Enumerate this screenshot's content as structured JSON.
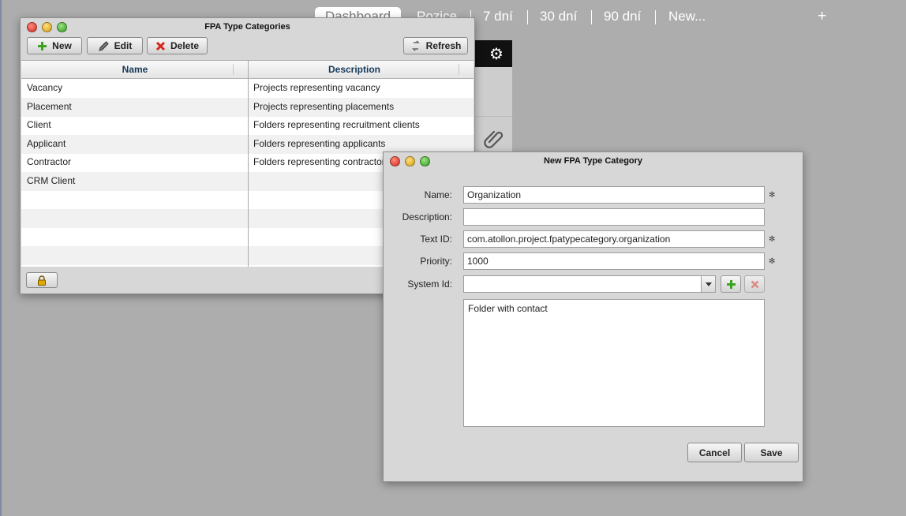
{
  "topnav": {
    "tabs": [
      "Dashboard",
      "Pozice",
      "7 dní",
      "30 dní",
      "90 dní",
      "New..."
    ],
    "add_label": "+"
  },
  "list_window": {
    "title": "FPA Type Categories",
    "toolbar": {
      "new": "New",
      "edit": "Edit",
      "delete": "Delete",
      "refresh": "Refresh"
    },
    "columns": [
      "Name",
      "Description"
    ],
    "rows": [
      {
        "name": "Vacancy",
        "description": "Projects representing vacancy"
      },
      {
        "name": "Placement",
        "description": "Projects representing placements"
      },
      {
        "name": "Client",
        "description": "Folders representing recruitment clients"
      },
      {
        "name": "Applicant",
        "description": "Folders representing applicants"
      },
      {
        "name": "Contractor",
        "description": "Folders representing contractors"
      },
      {
        "name": "CRM Client",
        "description": ""
      }
    ]
  },
  "form_window": {
    "title": "New FPA Type Category",
    "labels": {
      "name": "Name:",
      "description": "Description:",
      "text_id": "Text ID:",
      "priority": "Priority:",
      "system_id": "System Id:"
    },
    "values": {
      "name": "Organization",
      "description": "",
      "text_id": "com.atollon.project.fpatypecategory.organization",
      "priority": "1000",
      "system_id": "",
      "notes": "Folder with contact"
    },
    "required_mark": "✻",
    "buttons": {
      "cancel": "Cancel",
      "save": "Save"
    }
  },
  "colors": {
    "background": "#adadad",
    "add_icon": "#3aa41e",
    "delete_icon": "#d9261c"
  },
  "icons": [
    "gear-icon",
    "paperclip-icon",
    "lock-icon",
    "plus-icon",
    "pencil-icon",
    "delete-x-icon",
    "refresh-icon",
    "dropdown-arrow-icon"
  ]
}
